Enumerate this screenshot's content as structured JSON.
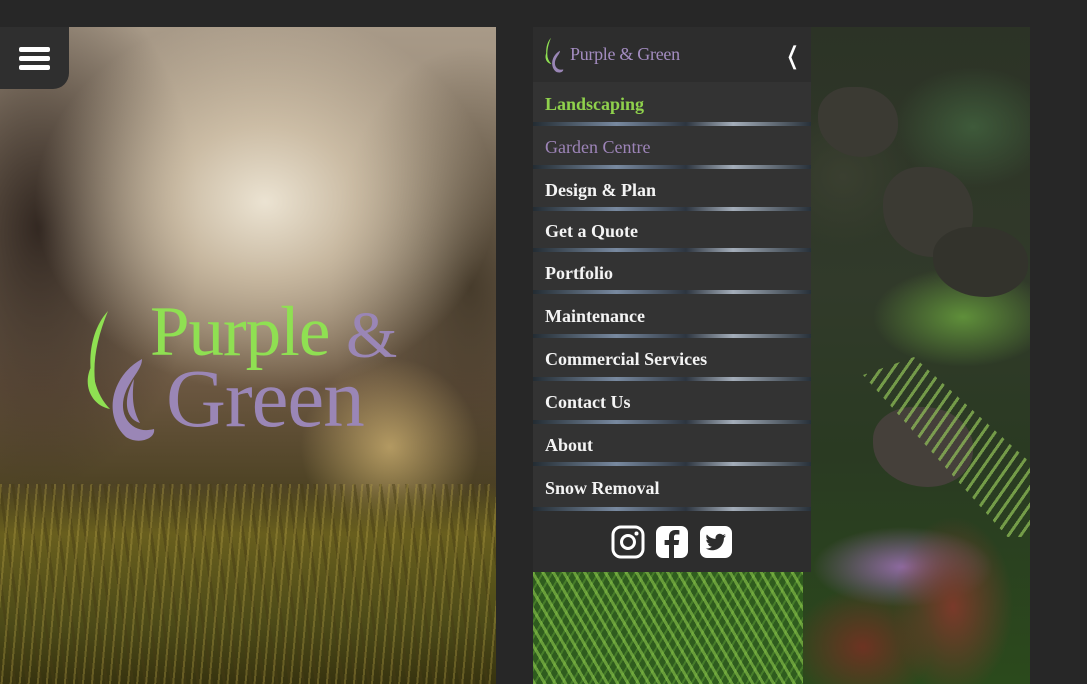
{
  "left_screen": {
    "logo": {
      "word1": "Purple",
      "ampersand": "&",
      "word2": "Green"
    }
  },
  "drawer": {
    "brand_name": "Purple & Green",
    "collapse_glyph": "❬",
    "nav_items": [
      {
        "label": "Landscaping"
      },
      {
        "label": "Garden Centre"
      },
      {
        "label": "Design & Plan"
      },
      {
        "label": "Get a Quote"
      },
      {
        "label": "Portfolio"
      },
      {
        "label": "Maintenance"
      },
      {
        "label": "Commercial Services"
      },
      {
        "label": "Contact Us"
      },
      {
        "label": "About"
      },
      {
        "label": "Snow Removal"
      }
    ],
    "social": [
      "instagram-icon",
      "facebook-icon",
      "twitter-icon"
    ]
  },
  "colors": {
    "brand_green": "#8fd14c",
    "brand_purple": "#9d84b8",
    "drawer_bg": "#2d2d2d",
    "page_bg": "#272727"
  }
}
